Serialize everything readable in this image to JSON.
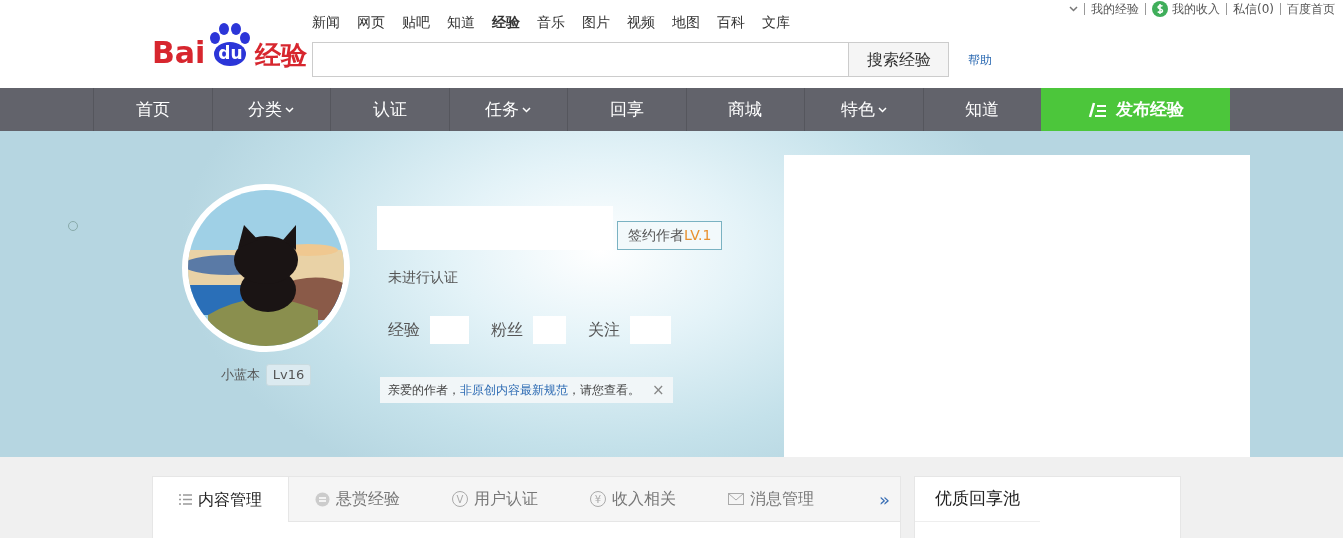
{
  "top_links": [
    {
      "label": "我的经验",
      "kind": "link"
    },
    {
      "label": "我的收入",
      "kind": "money"
    },
    {
      "label": "私信(0)",
      "kind": "link"
    },
    {
      "label": "百度首页",
      "kind": "link"
    }
  ],
  "logo": {
    "left": "Bai",
    "paw": "du",
    "right": "经验"
  },
  "search_tabs": [
    {
      "label": "新闻",
      "selected": false
    },
    {
      "label": "网页",
      "selected": false
    },
    {
      "label": "贴吧",
      "selected": false
    },
    {
      "label": "知道",
      "selected": false
    },
    {
      "label": "经验",
      "selected": true
    },
    {
      "label": "音乐",
      "selected": false
    },
    {
      "label": "图片",
      "selected": false
    },
    {
      "label": "视频",
      "selected": false
    },
    {
      "label": "地图",
      "selected": false
    },
    {
      "label": "百科",
      "selected": false
    },
    {
      "label": "文库",
      "selected": false
    }
  ],
  "search": {
    "button": "搜索经验",
    "help": "帮助"
  },
  "nav": [
    {
      "label": "首页",
      "has_menu": false
    },
    {
      "label": "分类",
      "has_menu": true
    },
    {
      "label": "认证",
      "has_menu": false
    },
    {
      "label": "任务",
      "has_menu": true
    },
    {
      "label": "回享",
      "has_menu": false
    },
    {
      "label": "商城",
      "has_menu": false
    },
    {
      "label": "特色",
      "has_menu": true
    },
    {
      "label": "知道",
      "has_menu": false
    }
  ],
  "publish_button": "发布经验",
  "profile": {
    "username": "小蓝本",
    "level": "Lv16",
    "badge": "签约作者",
    "badge_level": "LV.1",
    "certification": "未进行认证",
    "stats": [
      {
        "label": "经验"
      },
      {
        "label": "粉丝"
      },
      {
        "label": "关注"
      }
    ],
    "notice": {
      "prefix": "亲爱的作者，",
      "link": "非原创内容最新规范",
      "suffix": "，请您查看。",
      "close": "×"
    }
  },
  "tabs": [
    {
      "label": "内容管理",
      "kind": "list",
      "selected": true
    },
    {
      "label": "悬赏经验",
      "kind": "coin",
      "selected": false
    },
    {
      "label": "用户认证",
      "kind": "glyph",
      "glyph": "V",
      "selected": false
    },
    {
      "label": "收入相关",
      "kind": "glyph",
      "glyph": "¥",
      "selected": false
    },
    {
      "label": "消息管理",
      "kind": "mail",
      "selected": false
    }
  ],
  "tabs_more": "»",
  "side_panel": {
    "title": "优质回享池"
  }
}
